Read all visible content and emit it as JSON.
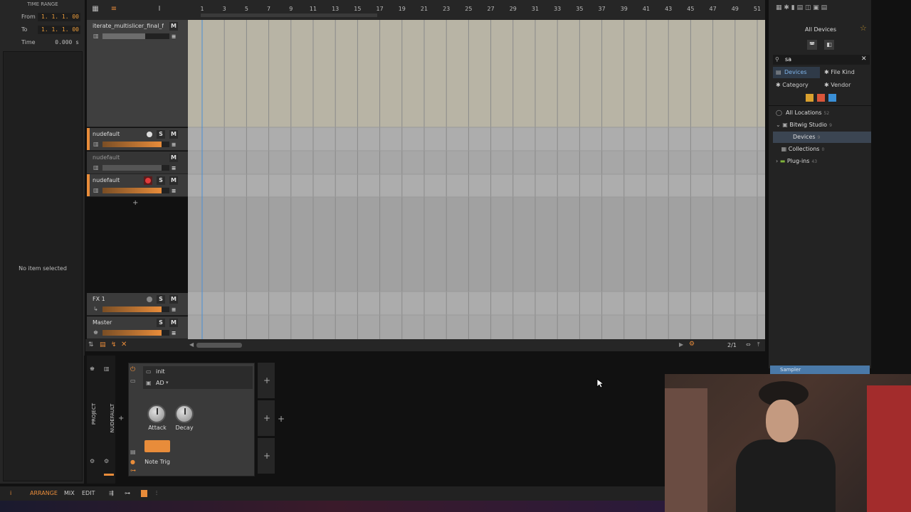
{
  "inspector": {
    "header": "TIME RANGE",
    "from_label": "From",
    "from_value": "1. 1. 1. 00",
    "to_label": "To",
    "to_value": "1. 1. 1. 00",
    "time_label": "Time",
    "time_value": "0.000 s",
    "empty_message": "No item selected"
  },
  "ruler": {
    "bars": [
      "1",
      "3",
      "5",
      "7",
      "9",
      "11",
      "13",
      "15",
      "17",
      "19",
      "21",
      "23",
      "25",
      "27",
      "29",
      "31",
      "33",
      "35",
      "37",
      "39",
      "41",
      "43",
      "45",
      "47",
      "49",
      "51"
    ]
  },
  "tracks": [
    {
      "name": "iterate_multislicer_final_final...",
      "mute": "M"
    },
    {
      "name": "nudefault",
      "solo": "S",
      "mute": "M"
    },
    {
      "name": "nudefault",
      "mute": "M"
    },
    {
      "name": "nudefault",
      "solo": "S",
      "mute": "M"
    },
    {
      "name": "FX 1",
      "solo": "S",
      "mute": "M"
    },
    {
      "name": "Master",
      "solo": "S",
      "mute": "M"
    }
  ],
  "add_track_symbol": "+",
  "arranger_footer": {
    "zoom_label": "2/1"
  },
  "browser": {
    "title": "All Devices",
    "search_value": "sa",
    "tabs": {
      "devices": "Devices",
      "file_kind": "File Kind",
      "category": "Category",
      "vendor": "Vendor"
    },
    "tree": [
      {
        "label": "All Locations",
        "count": "52"
      },
      {
        "label": "Bitwig Studio",
        "count": "9"
      },
      {
        "label": "Devices",
        "count": "9"
      },
      {
        "label": "Collections",
        "count": "0"
      },
      {
        "label": "Plug-ins",
        "count": "43"
      }
    ],
    "preview_item": "Sampler"
  },
  "device": {
    "preset": "init",
    "mode": "AD",
    "attack_label": "Attack",
    "decay_label": "Decay",
    "trigger_label": "Note Trig",
    "side_project": "PROJECT",
    "side_track": "NUDEFAULT",
    "accent": "#e88c3a"
  },
  "bottombar": {
    "arrange": "ARRANGE",
    "mix": "MIX",
    "edit": "EDIT",
    "info": "i"
  },
  "colors": {
    "accent_orange": "#e88c3a",
    "record_red": "#e23b3b",
    "selection_blue": "#4a8fd6"
  }
}
